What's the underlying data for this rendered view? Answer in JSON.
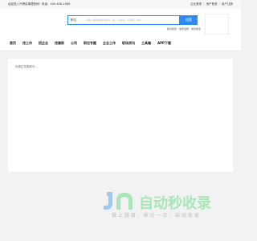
{
  "topbar": {
    "left_text": "欢迎进入汽博百事理官网！电话：400-636-1066",
    "links": [
      "企业登录",
      "用户登录",
      "用户注册"
    ],
    "separator": "|"
  },
  "search": {
    "type_label": "职位",
    "placeholder": "请输入要搜索的关键词，如：公务员、计算机、会计……",
    "button_label": "搜索",
    "hotwords": [
      "职位搜索",
      "免费招聘",
      "简历搜索"
    ]
  },
  "nav": {
    "items": [
      "首页",
      "找工作",
      "招企业",
      "找兼职",
      "公司",
      "职位专题",
      "企业工作",
      "职场资讯",
      "工具箱",
      "APP下载"
    ]
  },
  "main": {
    "status_text": "页面正在跳转中..."
  },
  "watermark": {
    "title": "自动秒收录",
    "subtitle": "做 上 链 接 ， 来 访 一 次 ， 自 动 收 录"
  },
  "colors": {
    "accent": "#2b8cf7",
    "watermark_green": "#a8e6b8",
    "watermark_blue": "#9ec9f0"
  }
}
